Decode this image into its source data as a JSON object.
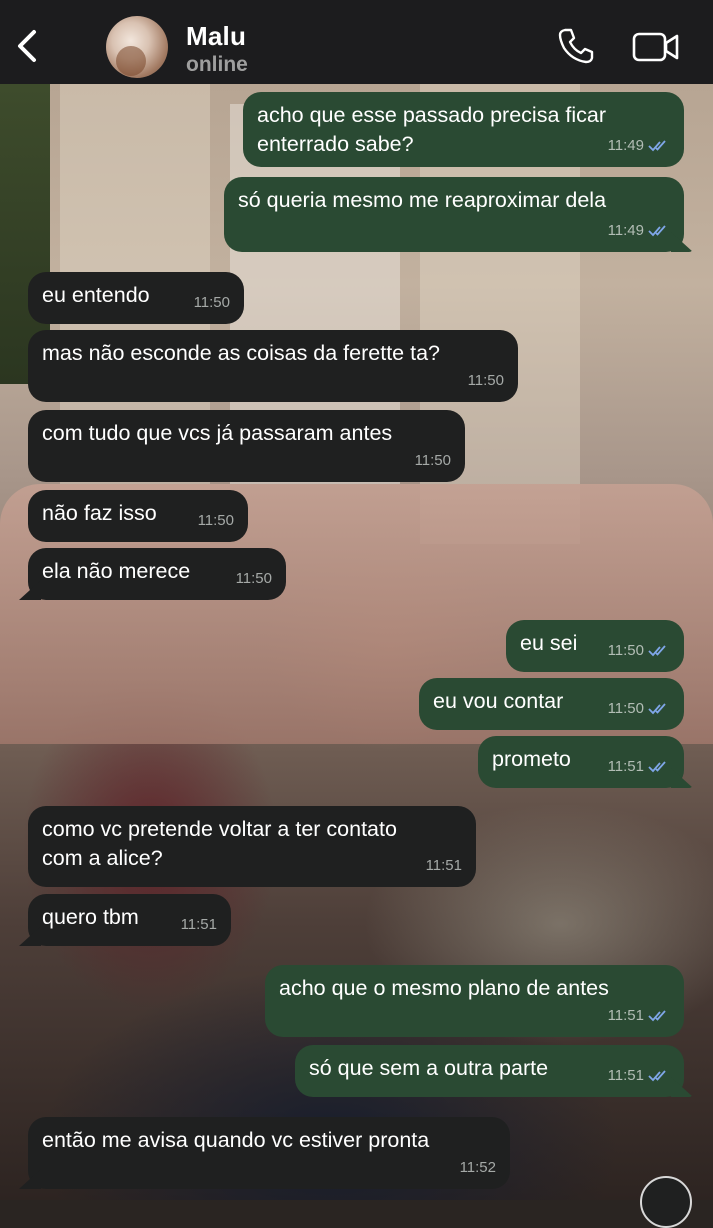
{
  "header": {
    "contact_name": "Malu",
    "status": "online",
    "icons": [
      "back-chevron-icon",
      "phone-icon",
      "video-camera-icon"
    ]
  },
  "colors": {
    "header_bg": "#1c1c1e",
    "incoming_bubble": "#1f2020",
    "outgoing_bubble": "#2a4a33",
    "read_ticks": "#7fa6e8"
  },
  "messages": [
    {
      "direction": "out",
      "text": "acho que esse passado precisa ficar\nenterrado sabe?",
      "time": "11:49",
      "read": true
    },
    {
      "direction": "out",
      "text": "só queria mesmo me reaproximar dela",
      "time": "11:49",
      "read": true
    },
    {
      "direction": "in",
      "text": "eu entendo",
      "time": "11:50"
    },
    {
      "direction": "in",
      "text": "mas não esconde as coisas da ferette ta?",
      "time": "11:50"
    },
    {
      "direction": "in",
      "text": "com tudo que vcs já passaram antes",
      "time": "11:50"
    },
    {
      "direction": "in",
      "text": "não faz isso",
      "time": "11:50"
    },
    {
      "direction": "in",
      "text": "ela não merece",
      "time": "11:50"
    },
    {
      "direction": "out",
      "text": "eu sei",
      "time": "11:50",
      "read": true
    },
    {
      "direction": "out",
      "text": "eu vou contar",
      "time": "11:50",
      "read": true
    },
    {
      "direction": "out",
      "text": "prometo",
      "time": "11:51",
      "read": true
    },
    {
      "direction": "in",
      "text": "como vc pretende voltar a ter contato\ncom a alice?",
      "time": "11:51"
    },
    {
      "direction": "in",
      "text": "quero tbm",
      "time": "11:51"
    },
    {
      "direction": "out",
      "text": "acho que o mesmo plano de antes",
      "time": "11:51",
      "read": true
    },
    {
      "direction": "out",
      "text": "só que sem a outra parte",
      "time": "11:51",
      "read": true
    },
    {
      "direction": "in",
      "text": "então me avisa quando vc estiver pronta",
      "time": "11:52"
    }
  ]
}
